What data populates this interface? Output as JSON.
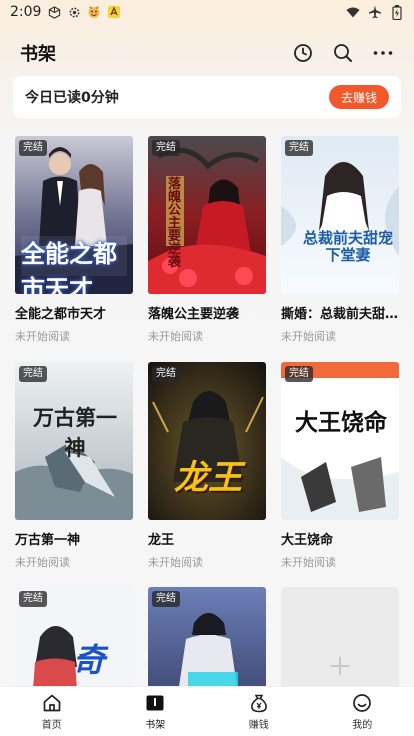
{
  "status_bar": {
    "time": "2:09"
  },
  "header": {
    "title": "书架",
    "history_icon": "clock-icon",
    "search_icon": "search-icon",
    "more_icon": "more-icon"
  },
  "reading_banner": {
    "text": "今日已读0分钟",
    "button_label": "去赚钱",
    "button_color": "#f1582b"
  },
  "books": [
    {
      "title": "全能之都市天才",
      "status": "未开始阅读",
      "badge": "完结",
      "cover_text": "全能之都市天才"
    },
    {
      "title": "落魄公主要逆袭",
      "status": "未开始阅读",
      "badge": "完结",
      "cover_text": "落魄公主要逆袭"
    },
    {
      "title": "撕婚：总裁前夫甜宠下堂妻",
      "status": "未开始阅读",
      "badge": "完结",
      "cover_text": "总裁前夫甜宠下堂妻"
    },
    {
      "title": "万古第一神",
      "status": "未开始阅读",
      "badge": "完结",
      "cover_text": "万古第一神"
    },
    {
      "title": "龙王",
      "status": "未开始阅读",
      "badge": "完结",
      "cover_text": "龙王"
    },
    {
      "title": "大王饶命",
      "status": "未开始阅读",
      "badge": "完结",
      "cover_text": "大王饶命"
    },
    {
      "title": "",
      "status": "",
      "badge": "完结",
      "cover_text": "奇剑"
    },
    {
      "title": "",
      "status": "",
      "badge": "完结",
      "cover_text": ""
    }
  ],
  "bottom_nav": [
    {
      "label": "首页",
      "icon": "home-icon"
    },
    {
      "label": "书架",
      "icon": "bookshelf-icon",
      "active": true
    },
    {
      "label": "赚钱",
      "icon": "money-bag-icon"
    },
    {
      "label": "我的",
      "icon": "profile-icon"
    }
  ]
}
